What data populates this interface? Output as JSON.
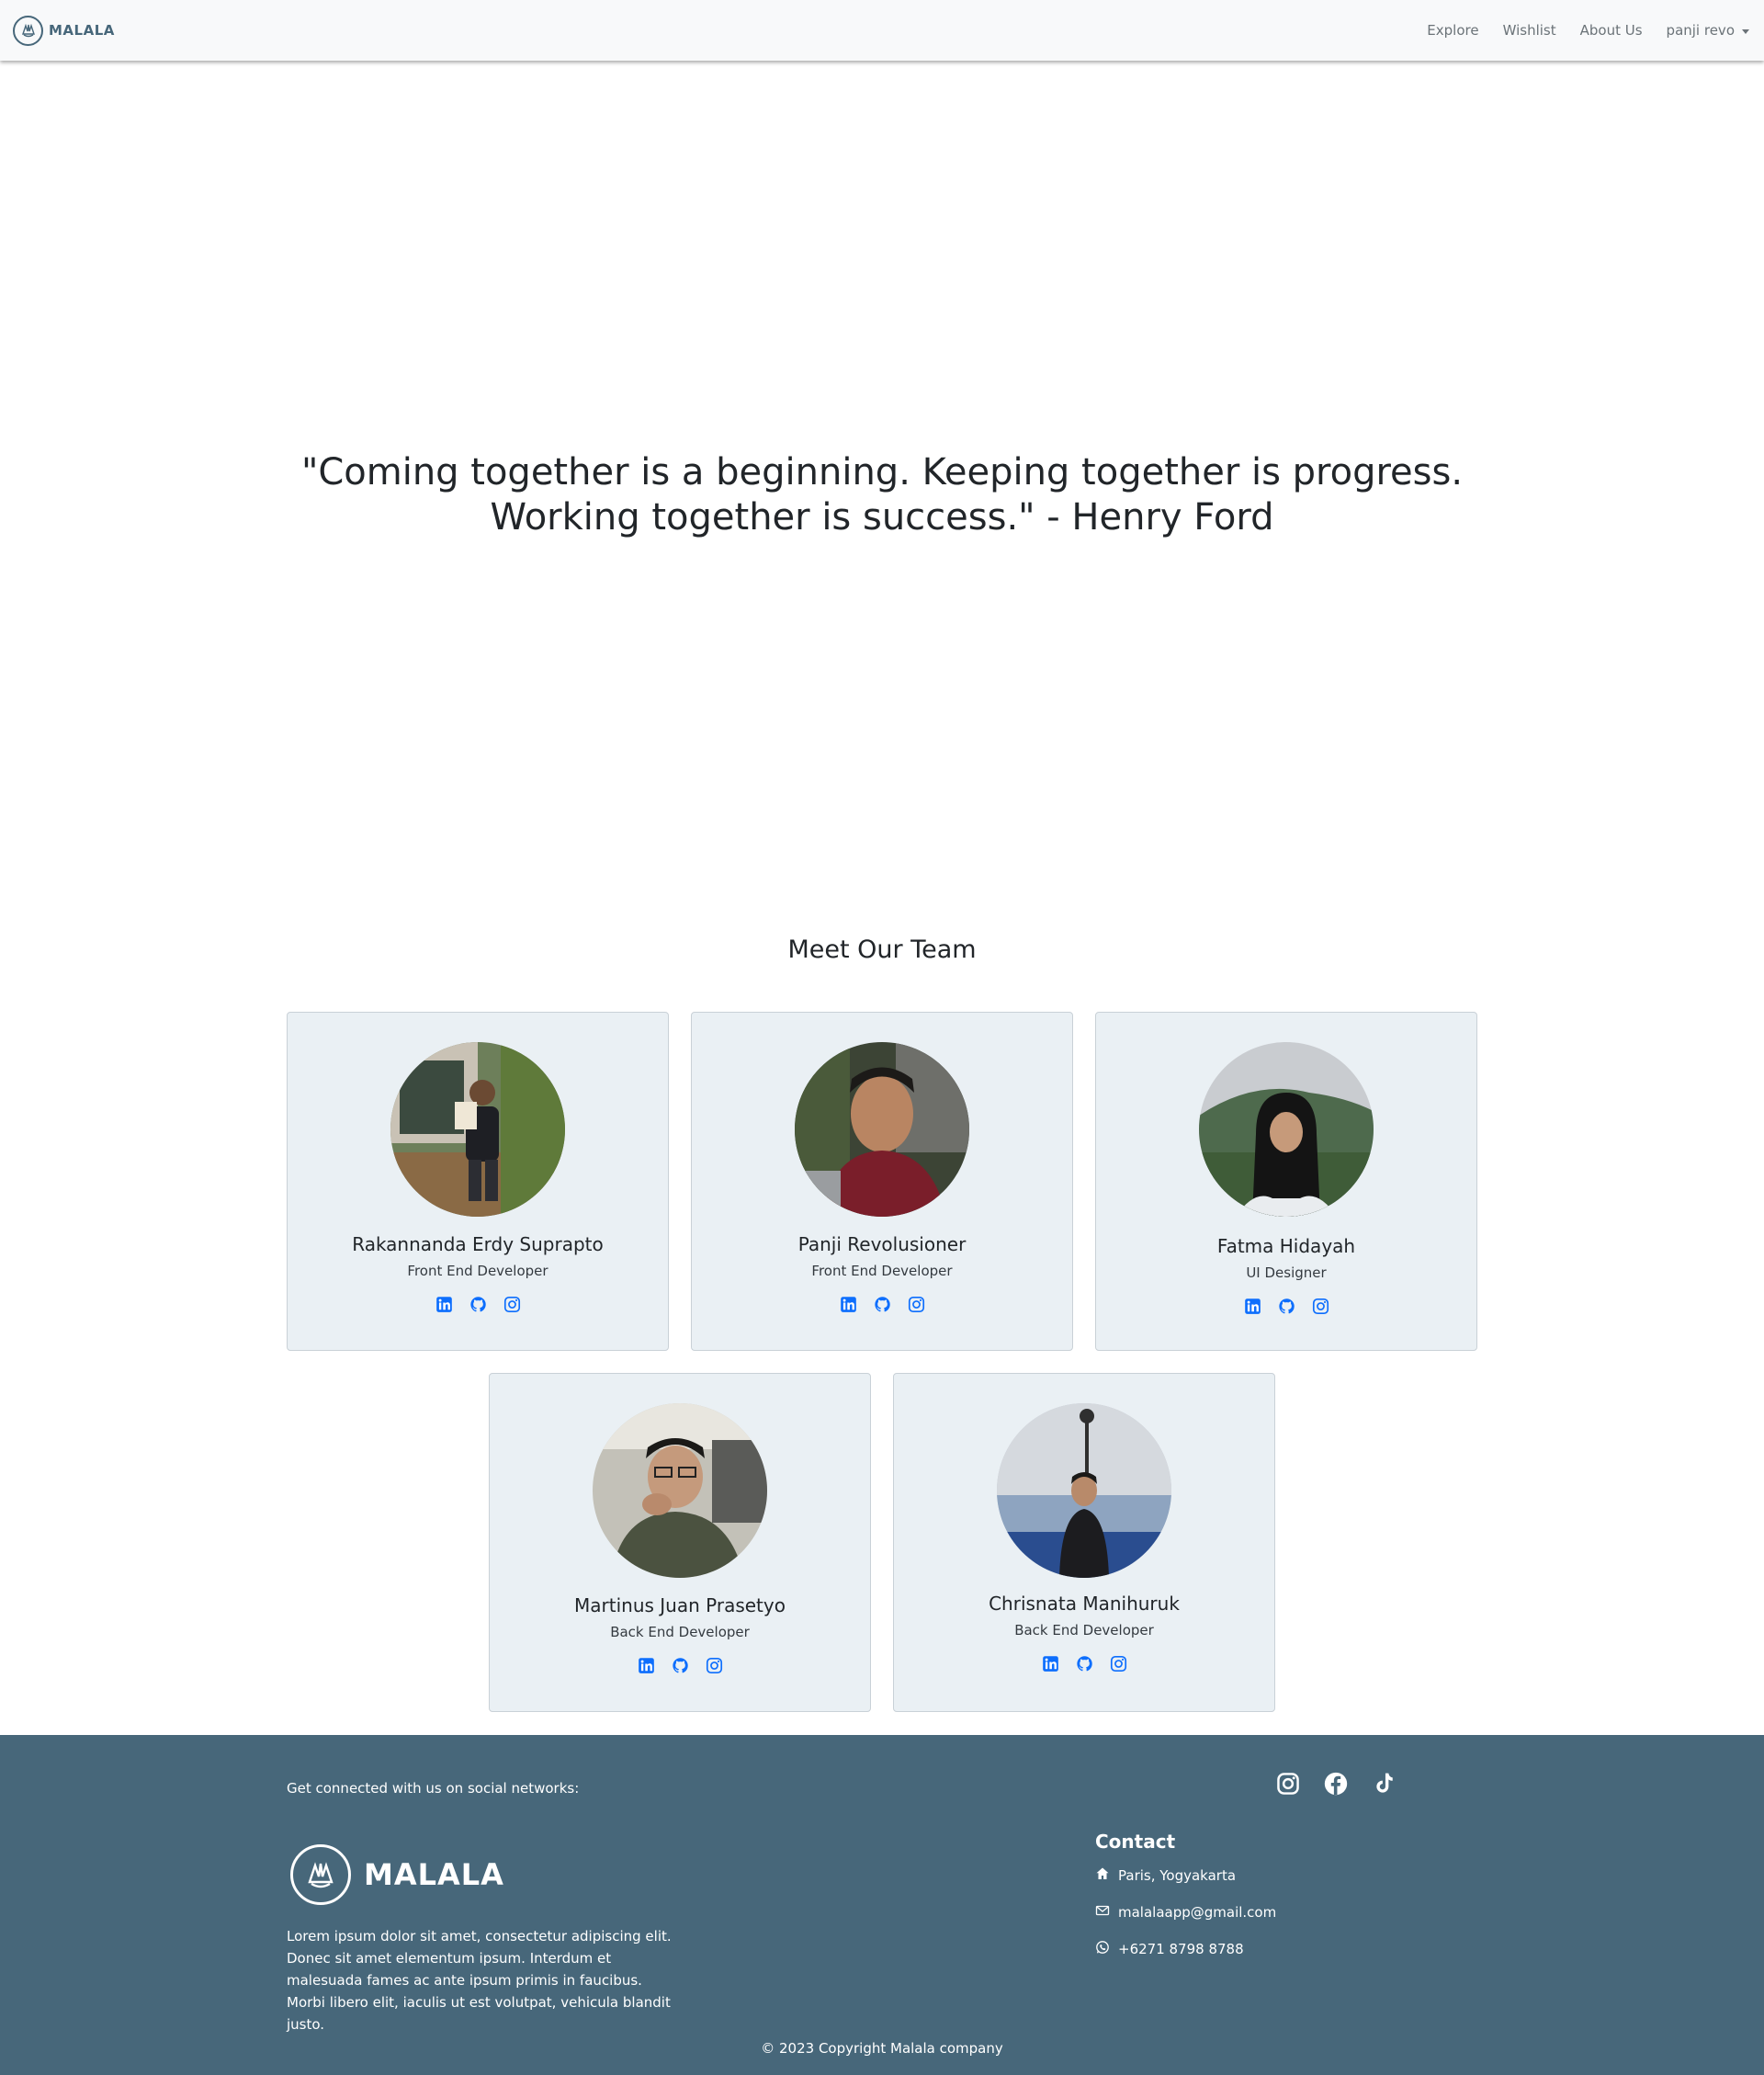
{
  "navbar": {
    "brand": "MALALA",
    "links": [
      "Explore",
      "Wishlist",
      "About Us"
    ],
    "user": "panji revo"
  },
  "quote": {
    "line1": "\"Coming together is a beginning. Keeping together is progress.",
    "line2": "Working together is success.\" - Henry Ford"
  },
  "team": {
    "title": "Meet Our Team",
    "members": [
      {
        "name": "Rakannanda Erdy Suprapto",
        "role": "Front End Developer"
      },
      {
        "name": "Panji Revolusioner",
        "role": "Front End Developer"
      },
      {
        "name": "Fatma Hidayah",
        "role": "UI Designer"
      },
      {
        "name": "Martinus Juan Prasetyo",
        "role": "Back End Developer"
      },
      {
        "name": "Chrisnata Manihuruk",
        "role": "Back End Developer"
      }
    ],
    "social_icons": [
      "linkedin-icon",
      "github-icon",
      "instagram-icon"
    ]
  },
  "footer": {
    "connect": "Get connected with us on social networks:",
    "social_icons": [
      "instagram-icon",
      "facebook-icon",
      "tiktok-icon"
    ],
    "brand": "MALALA",
    "description": "Lorem ipsum dolor sit amet, consectetur adipiscing elit. Donec sit amet elementum ipsum. Interdum et malesuada fames ac ante ipsum primis in faucibus. Morbi libero elit, iaculis ut est volutpat, vehicula blandit justo.",
    "contact_title": "Contact",
    "address": "Paris, Yogyakarta",
    "email": "malalaapp@gmail.com",
    "phone": "+6271 8798 8788",
    "copyright": "© 2023 Copyright Malala company"
  },
  "colors": {
    "navbar_bg": "#f8f9fa",
    "brand": "#47677a",
    "card_bg": "#eaf0f4",
    "icon_blue": "#0d6efd",
    "footer_bg": "#47677a"
  }
}
